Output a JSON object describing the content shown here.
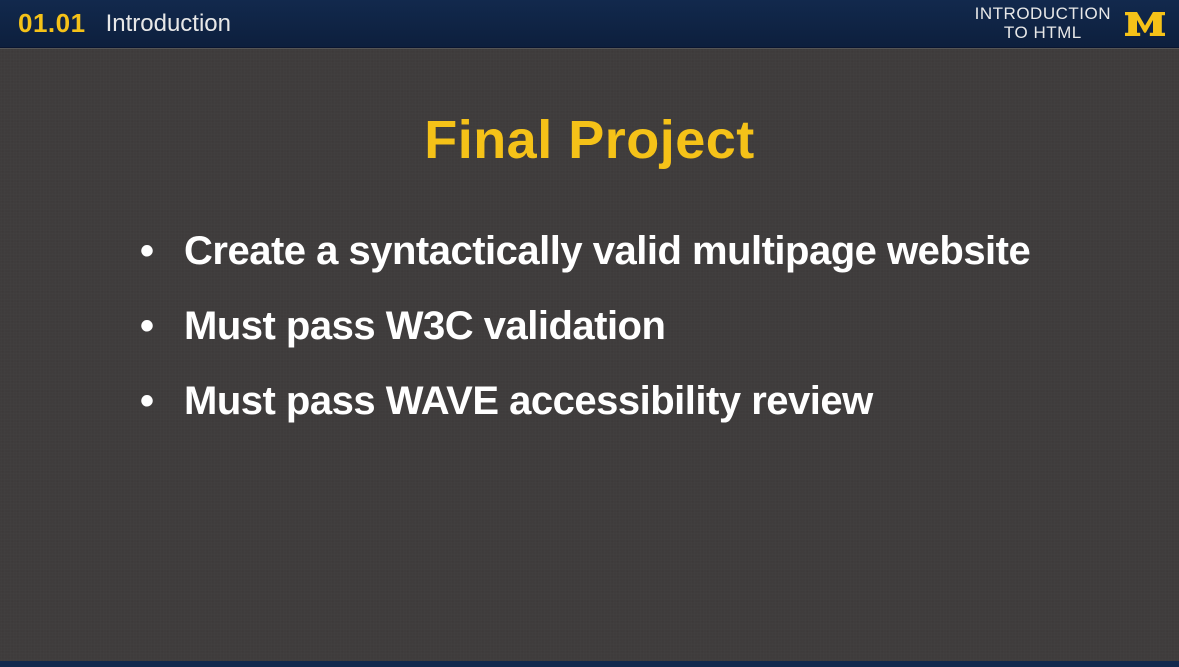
{
  "header": {
    "lesson_number": "01.01",
    "lesson_title": "Introduction",
    "course_title": "INTRODUCTION\nTO HTML",
    "logo_name": "M"
  },
  "slide": {
    "title": "Final Project",
    "bullets": [
      "Create a syntactically valid multipage website",
      "Must pass  W3C validation",
      "Must pass WAVE accessibility review"
    ]
  },
  "colors": {
    "accent_yellow": "#f5c218",
    "header_blue": "#12294d",
    "body_bg": "#3f3c3c",
    "text_white": "#ffffff"
  }
}
